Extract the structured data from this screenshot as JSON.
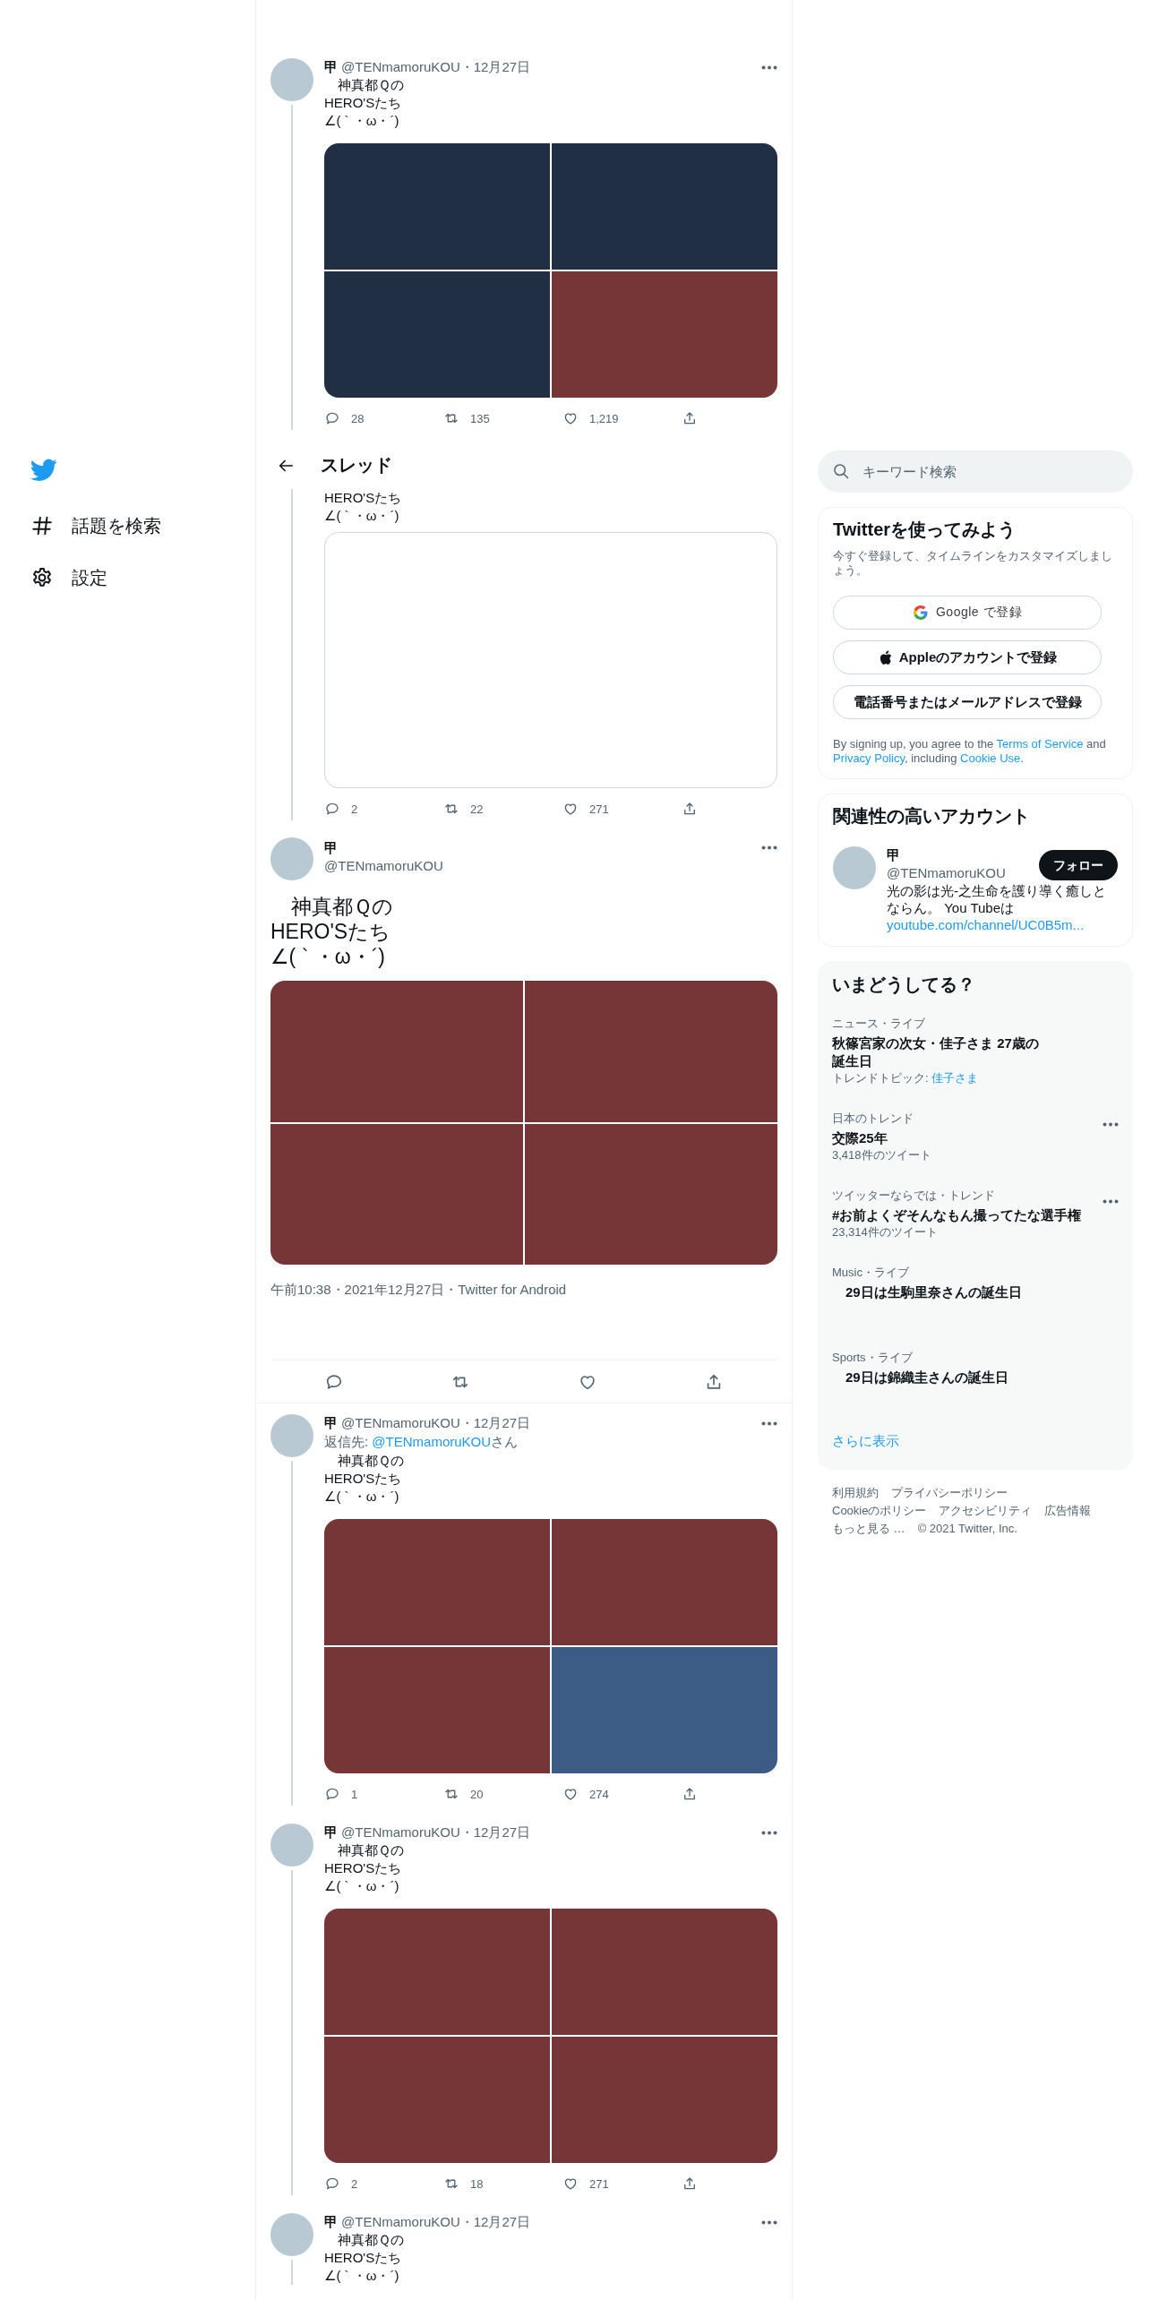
{
  "sidebar": {
    "items": [
      {
        "kind": "explore",
        "label": "話題を検索"
      },
      {
        "kind": "settings",
        "label": "設定"
      }
    ]
  },
  "thread_before": [
    {
      "name": "甲",
      "meta": "@TENmamoruKOU・12月27日",
      "lines": [
        "　神真都Ｑの",
        "HERO'Sたち",
        "∠( ` ・ω・´)"
      ],
      "media": {
        "kind": "grid",
        "tiles": [
          {
            "color": "#212f45"
          },
          {
            "color": "#212f45"
          },
          {
            "color": "#212f45"
          },
          {
            "color": "#763537"
          }
        ]
      },
      "actions": {
        "replies": "28",
        "retweets": "135",
        "likes": "1,219"
      }
    },
    {
      "lines": [
        "HERO'Sたち",
        "∠( ` ・ω・´)"
      ],
      "media": {
        "kind": "empty"
      },
      "actions": {
        "replies": "2",
        "retweets": "22",
        "likes": "271"
      }
    }
  ],
  "header": {
    "title": "スレッド"
  },
  "focused_tweet": {
    "name": "甲",
    "handle": "@TENmamoruKOU",
    "lines": [
      "　神真都Ｑの",
      "HERO'Sたち",
      "∠( ` ・ω・´)"
    ],
    "media": {
      "kind": "grid",
      "tiles": [
        {
          "color": "#763537"
        },
        {
          "color": "#763537"
        },
        {
          "color": "#763537"
        },
        {
          "color": "#763537"
        }
      ]
    },
    "timestamp": "午前10:38・2021年12月27日・Twitter for Android"
  },
  "replies": [
    {
      "name": "甲",
      "meta": "@TENmamoruKOU・12月27日",
      "reply_to": {
        "prefix": "返信先: ",
        "handle": "@TENmamoruKOU",
        "suffix": "さん"
      },
      "lines": [
        "　神真都Ｑの",
        "HERO'Sたち",
        "∠( ` ・ω・´)"
      ],
      "media": {
        "kind": "grid",
        "tiles": [
          {
            "color": "#763537"
          },
          {
            "color": "#763537"
          },
          {
            "color": "#763537"
          },
          {
            "color": "#3c5c85"
          }
        ]
      },
      "actions": {
        "replies": "1",
        "retweets": "20",
        "likes": "274"
      }
    },
    {
      "name": "甲",
      "meta": "@TENmamoruKOU・12月27日",
      "lines": [
        "　神真都Ｑの",
        "HERO'Sたち",
        "∠( ` ・ω・´)"
      ],
      "media": {
        "kind": "grid",
        "tiles": [
          {
            "color": "#763537"
          },
          {
            "color": "#763537"
          },
          {
            "color": "#763537"
          },
          {
            "color": "#763537"
          }
        ]
      },
      "actions": {
        "replies": "2",
        "retweets": "18",
        "likes": "271"
      }
    },
    {
      "name": "甲",
      "meta": "@TENmamoruKOU・12月27日",
      "lines": [
        "　神真都Ｑの",
        "HERO'Sたち",
        "∠( ` ・ω・´)"
      ]
    }
  ],
  "search": {
    "placeholder": "キーワード検索"
  },
  "signup": {
    "title": "Twitterを使ってみよう",
    "subtitle": "今すぐ登録して、タイムラインをカスタマイズしましょう。",
    "buttons": [
      {
        "kind": "google",
        "label": "Google で登録"
      },
      {
        "kind": "apple",
        "label": "Appleのアカウントで登録"
      },
      {
        "kind": "plain",
        "label": "電話番号またはメールアドレスで登録"
      }
    ],
    "legal": [
      {
        "kind": "text",
        "text": "By signing up, you agree to the "
      },
      {
        "kind": "link",
        "text": "Terms of Service"
      },
      {
        "kind": "text",
        "text": " and "
      },
      {
        "kind": "link",
        "text": "Privacy Policy"
      },
      {
        "kind": "text",
        "text": ", including "
      },
      {
        "kind": "link",
        "text": "Cookie Use."
      }
    ]
  },
  "who_to_follow": {
    "title": "関連性の高いアカウント",
    "accounts": [
      {
        "name": "甲",
        "handle": "@TENmamoruKOU",
        "bio": "光の影は光-之生命を護り導く癒しとならん。 You Tubeは",
        "link": "youtube.com/channel/UC0B5m...",
        "button": "フォロー"
      }
    ]
  },
  "trends": {
    "title": "いまどうしてる？",
    "items": [
      {
        "category": "ニュース・ライブ",
        "title": "秋篠宮家の次女・佳子さま 27歳の誕生日",
        "meta": "トレンドトピック: ",
        "meta_link": "佳子さま",
        "more": false
      },
      {
        "category": "日本のトレンド",
        "title": "交際25年",
        "meta": "3,418件のツイート",
        "more": true
      },
      {
        "category": "ツイッターならでは・トレンド",
        "title": "#お前よくぞそんなもん撮ってたな選手権",
        "meta": "23,314件のツイート",
        "more": true
      },
      {
        "category": "Music・ライブ",
        "title": "　29日は生駒里奈さんの誕生日",
        "more": false
      },
      {
        "category": "Sports・ライブ",
        "title": "　29日は錦織圭さんの誕生日",
        "more": false
      }
    ],
    "show_more": "さらに表示"
  },
  "footer_rows": [
    [
      "利用規約",
      "プライバシーポリシー"
    ],
    [
      "Cookieのポリシー",
      "アクセシビリティ",
      "広告情報"
    ],
    [
      "もっと見る …",
      "© 2021 Twitter, Inc."
    ]
  ]
}
